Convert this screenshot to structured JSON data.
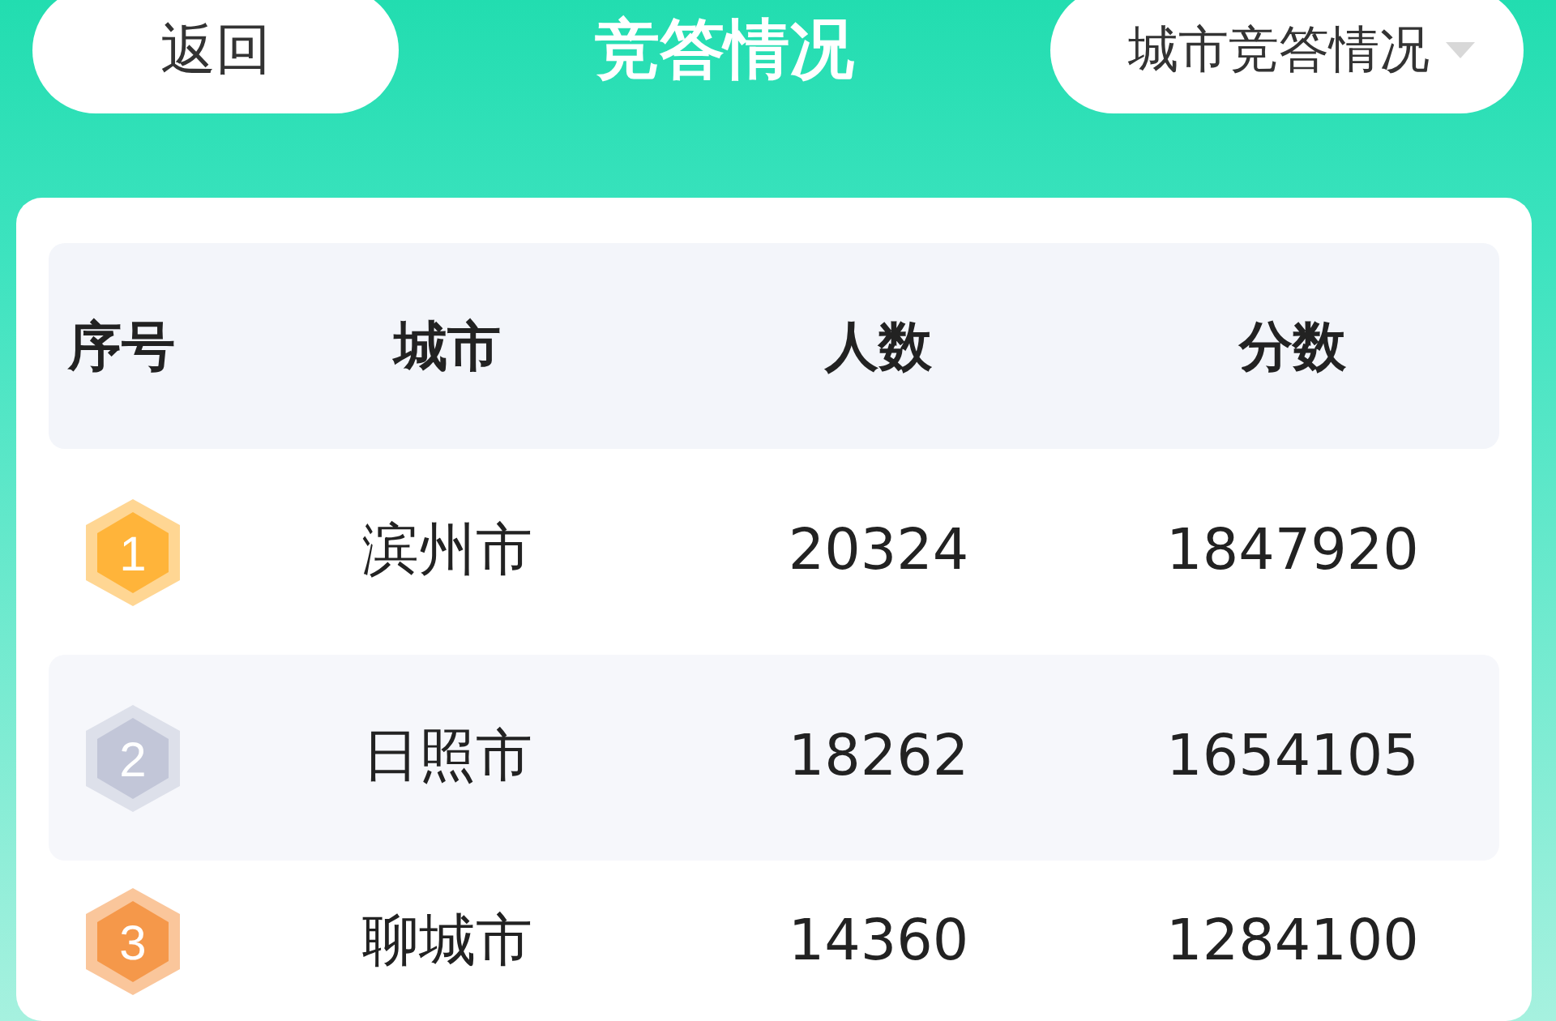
{
  "header": {
    "back_button": "返回",
    "title": "竞答情况",
    "dropdown": "城市竞答情况"
  },
  "table": {
    "columns": [
      "序号",
      "城市",
      "人数",
      "分数"
    ],
    "rows": [
      {
        "rank": "1",
        "color": "#ffb43a",
        "city": "滨州市",
        "people": "20324",
        "score": "1847920"
      },
      {
        "rank": "2",
        "color": "#c2c6d8",
        "city": "日照市",
        "people": "18262",
        "score": "1654105"
      },
      {
        "rank": "3",
        "color": "#f5984a",
        "city": "聊城市",
        "people": "14360",
        "score": "1284100"
      }
    ]
  }
}
